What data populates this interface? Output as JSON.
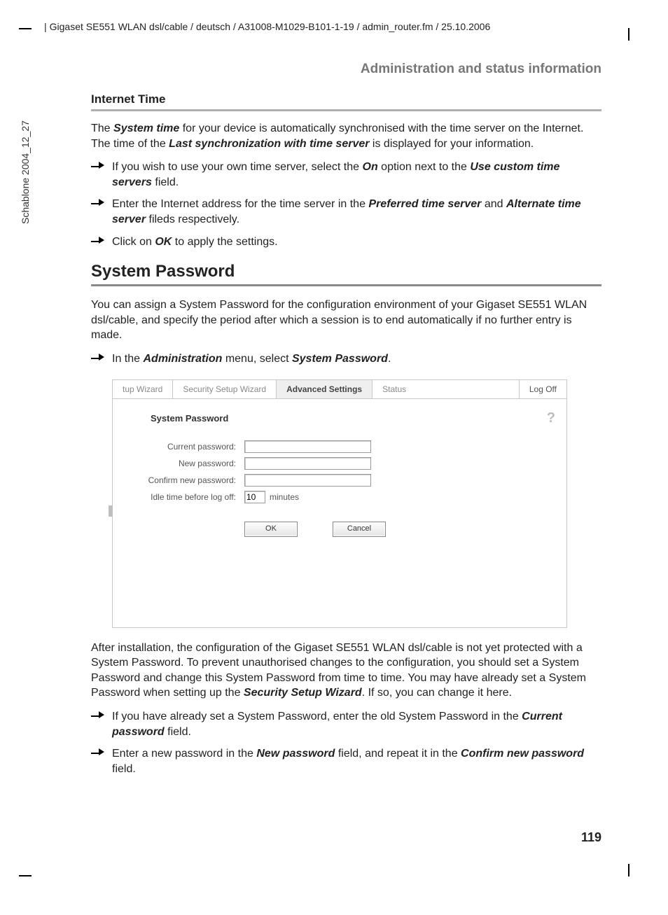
{
  "header_path": "Gigaset SE551 WLAN dsl/cable / deutsch / A31008-M1029-B101-1-19 / admin_router.fm / 25.10.2006",
  "side_text": "Schablone 2004_12_27",
  "section_header": "Administration and status information",
  "internet_time": {
    "heading": "Internet Time",
    "para1_pre": "The ",
    "para1_b1": "System time",
    "para1_mid1": " for your device is automatically synchronised with the time server on the Internet. The time of the ",
    "para1_b2": "Last synchronization with time server",
    "para1_post": " is displayed for your information.",
    "bul1_pre": "If you wish to use your own time server, select the ",
    "bul1_b1": "On",
    "bul1_mid": " option next to the ",
    "bul1_b2": "Use custom time servers",
    "bul1_post": " field.",
    "bul2_pre": "Enter the Internet address for the time server in the ",
    "bul2_b1": "Preferred time server",
    "bul2_mid": " and ",
    "bul2_b2": "Alternate time server",
    "bul2_post": " fileds respectively.",
    "bul3_pre": "Click on ",
    "bul3_b1": "OK",
    "bul3_post": " to apply the settings."
  },
  "system_password": {
    "heading": "System Password",
    "para1": "You can assign a System Password for the configuration environment of your Gigaset SE551 WLAN dsl/cable, and specify the period after which a session is to end automatically if no further entry is made.",
    "bul1_pre": "In the ",
    "bul1_b1": "Administration",
    "bul1_mid": " menu, select ",
    "bul1_b2": "System Password",
    "bul1_post": "."
  },
  "shot": {
    "tabs": {
      "t1": "tup Wizard",
      "t2": "Security Setup Wizard",
      "t3": "Advanced Settings",
      "t4": "Status",
      "logoff": "Log Off"
    },
    "title": "System Password",
    "labels": {
      "current": "Current password:",
      "new": "New password:",
      "confirm": "Confirm new password:",
      "idle": "Idle time before log off:"
    },
    "idle_value": "10",
    "idle_unit": "minutes",
    "ok": "OK",
    "cancel": "Cancel",
    "help": "?"
  },
  "after": {
    "para_pre": "After installation, the configuration of the Gigaset SE551 WLAN dsl/cable is not yet protected with a System Password. To prevent unauthorised changes to the configuration, you should set a System Password and change this System Password from time to time. You may have already set a System Password when setting up the ",
    "para_b1": "Security Setup Wizard",
    "para_post": ". If so, you can change it here.",
    "bul1_pre": "If you have already set a System Password, enter the old System Password in the ",
    "bul1_b1": "Current password",
    "bul1_post": " field.",
    "bul2_pre": "Enter a new password in the ",
    "bul2_b1": "New password",
    "bul2_mid": " field, and repeat it in the ",
    "bul2_b2": "Confirm new password",
    "bul2_post": " field."
  },
  "page_number": "119"
}
